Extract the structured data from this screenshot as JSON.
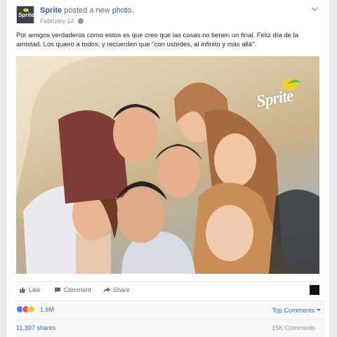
{
  "post": {
    "page_name": "Sprite",
    "action_text": "posted a new",
    "photo_link": "photo.",
    "date": "February 14",
    "text": "Por amigos verdaderos como estos es que creo que las cosas no tienen un final. Feliz día de la amistad. Los quiero a todos; y recuerden que \"con ustedes, al infinito y más allá\".",
    "avatar_label": "Sprite",
    "photo_brand": "Sprite"
  },
  "actions": {
    "like": "Like",
    "comment": "Comment",
    "share": "Share"
  },
  "stats": {
    "reaction_count": "1.6M",
    "top_comments": "Top Comments",
    "shares": "11,397 shares",
    "comments": "15K Comments"
  },
  "colors": {
    "link": "#365899",
    "like_blue": "#4080ff",
    "love_red": "#f25268",
    "wow_yellow": "#f7c33b"
  },
  "icons": [
    "globe-icon",
    "chevron-down-icon",
    "like-icon",
    "comment-icon",
    "share-icon"
  ]
}
